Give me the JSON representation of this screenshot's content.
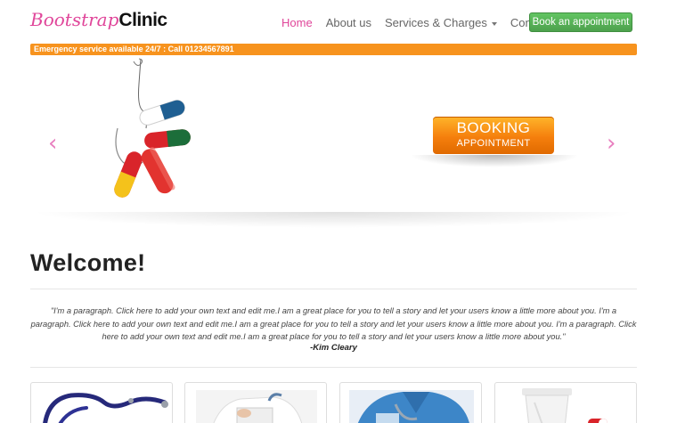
{
  "brand": {
    "part1": "Bootstrap",
    "part2": "Clinic"
  },
  "nav": {
    "items": [
      {
        "label": "Home"
      },
      {
        "label": "About us"
      },
      {
        "label": "Services & Charges"
      },
      {
        "label": "Contact"
      }
    ],
    "cta_label": "Book an appointment"
  },
  "alert": {
    "text": "Emergency service available 24/7 : Call 01234567891"
  },
  "carousel": {
    "prev_icon": "‹",
    "next_icon": "›",
    "booking_line1": "BOOKING",
    "booking_line2": "APPOINTMENT",
    "image": "pills-on-fishhook"
  },
  "welcome": {
    "title": "Welcome!",
    "quote": "\"I'm a paragraph. Click here to add your own text and edit me.I am a great place for you to tell a story and let your users know a little more about you. I'm a paragraph. Click here to add your own text and edit me.I am a great place for you to tell a story and let your users know a little more about you. I'm a paragraph. Click here to add your own text and edit me.I am a great place for you to tell a story and let your users know a little more about you.\"",
    "author": "-Kim Cleary"
  },
  "thumbnails": [
    {
      "image": "stethoscope"
    },
    {
      "image": "doctor-writing"
    },
    {
      "image": "nurse-scrubs"
    },
    {
      "image": "medicine-bottle"
    }
  ],
  "colors": {
    "brand_pink": "#e0469a",
    "cta_green": "#5cb85c",
    "alert_orange": "#f7931e",
    "booking_orange": "#f57f0d",
    "arrow_pink": "#e87fbf"
  }
}
